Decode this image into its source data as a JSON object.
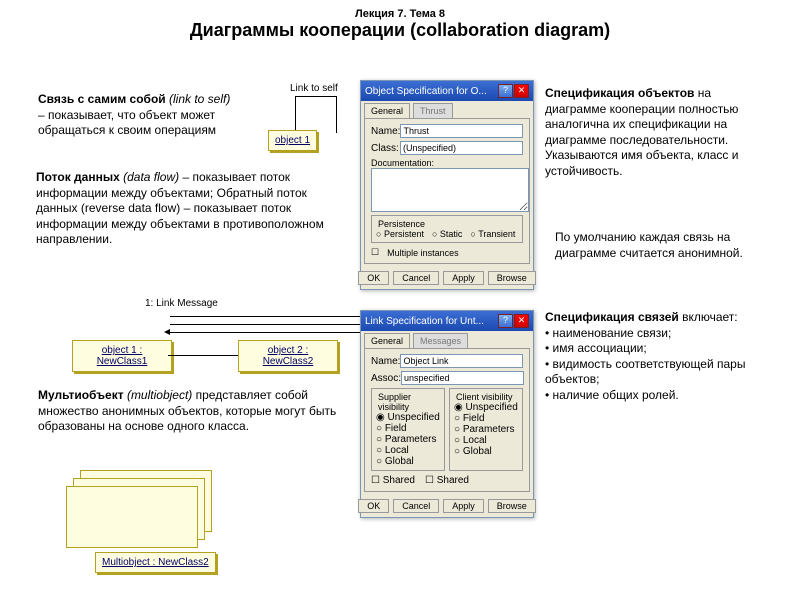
{
  "title_small": "Лекция 7. Тема 8",
  "title_main": "Диаграммы кооперации (collaboration diagram)",
  "link_to_self_label": "Link to self",
  "object1_label": "object 1",
  "text_link_self_prefix": "Связь с самим собой",
  "text_link_self_italic": " (link to self)",
  "text_link_self_rest": " – показывает, что объект может обращаться к своим операциям",
  "text_dataflow_prefix": "Поток данных",
  "text_dataflow_italic": " (data flow)",
  "text_dataflow_rest": " – показывает поток информации между объектами; Обратный поток данных (reverse data flow) – показывает поток информации между объектами в противоположном направлении.",
  "spec_obj_title": "Спецификация объектов",
  "spec_obj_text": " на диаграмме кооперации полностью аналогична их спецификации на диаграмме последовательности. Указываются имя объекта, класс и устойчивость.",
  "anon_text": "По умолчанию каждая связь на диаграмме считается анонимной.",
  "spec_link_title": "Спецификация связей",
  "spec_link_intro": " включает:",
  "spec_link_b1": "наименование связи;",
  "spec_link_b2": "имя ассоциации;",
  "spec_link_b3": "видимость соответствующей пары объектов;",
  "spec_link_b4": "наличие общих ролей.",
  "link_msg_label": "1: Link Message",
  "obj1_box": "object 1 : NewClass1",
  "obj2_box": "object 2 : NewClass2",
  "multi_prefix": "Мультиобъект",
  "multi_italic": " (multiobject)",
  "multi_rest": " представляет собой множество анонимных объектов, которые могут быть образованы на основе одного класса.",
  "multi_box_label": "Multiobject : NewClass2",
  "dlg1": {
    "title": "Object Specification for O...",
    "tab1": "General",
    "tab2": "Thrust",
    "name_lbl": "Name:",
    "name_val": "Thrust",
    "class_lbl": "Class:",
    "class_val": "(Unspecified)",
    "doc_lbl": "Documentation:",
    "pers_lbl": "Persistence",
    "r1": "Persistent",
    "r2": "Static",
    "r3": "Transient",
    "chk": "Multiple instances",
    "btn_ok": "OK",
    "btn_cancel": "Cancel",
    "btn_apply": "Apply",
    "btn_browse": "Browse"
  },
  "dlg2": {
    "title": "Link Specification for Unt...",
    "tab1": "General",
    "tab2": "Messages",
    "name_lbl": "Name:",
    "name_val": "Object Link",
    "assoc_lbl": "Assoc:",
    "assoc_val": "unspecified",
    "sup_lbl": "Supplier visibility",
    "cli_lbl": "Client visibility",
    "r1": "Unspecified",
    "r2": "Field",
    "r3": "Parameters",
    "r4": "Local",
    "r5": "Global",
    "shared": "Shared",
    "btn_ok": "OK",
    "btn_cancel": "Cancel",
    "btn_apply": "Apply",
    "btn_browse": "Browse"
  }
}
